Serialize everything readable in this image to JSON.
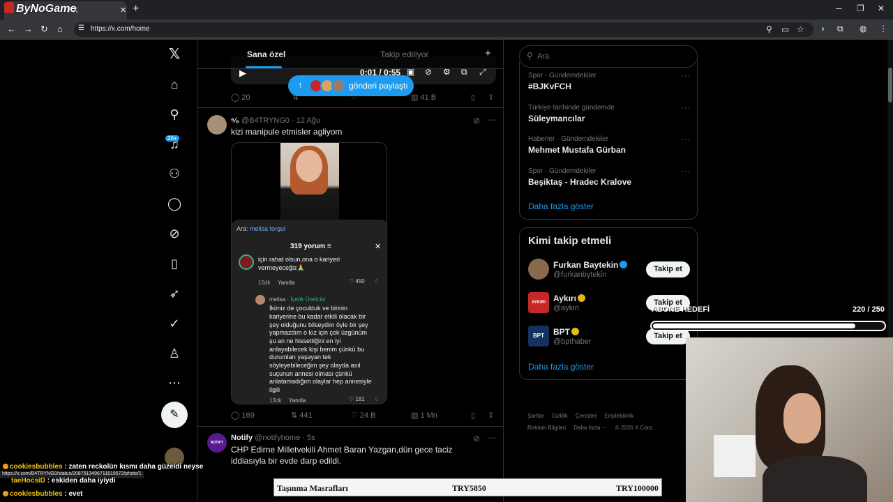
{
  "browser": {
    "tab_title": "/ X",
    "overlay_logo": "ByNoGame",
    "url": "https://x.com/home",
    "status_url": "https://x.com/B4TRYNG0/status/2087513496711819572/photo/1"
  },
  "timeline": {
    "tab_for_you": "Sana özel",
    "tab_following": "Takip ediliyor",
    "video": {
      "time": "0:01 / 0:55"
    },
    "share_pill": "gönderi paylaştı",
    "prev_post_actions": {
      "replies": "20",
      "views": "41 B"
    },
    "post1": {
      "name": "⁶⁄₆",
      "handle": "@B4TRYNG0 · 12 Ağu",
      "text": "kizi manipule etmisler agliyom",
      "media": {
        "search_prefix": "Ara:",
        "search_term": "melisa torgul",
        "comment_count": "319 yorum",
        "comment1_lines": [
          "için rahat olsun,ona o kariyeri",
          "vermeyeceğiz🙏"
        ],
        "comment1_time": "15dk",
        "comment1_reply": "Yanıtla",
        "comment1_likes": "450",
        "reply_author": "melisa",
        "reply_badge": "· İçerik Üreticisi",
        "reply_lines": [
          "İkimiz de çocuktuk ve birinin",
          "kariyerine bu kadar etkili olacak bir",
          "şey olduğunu bilseydim öyle bir şey",
          "yapmazdım o kız için çok üzgünüm",
          "şu an ne hissettiğini en iyi",
          "anlayabilecek kişi benim çünkü bu",
          "durumları yaşayan tek",
          "söyleyebileceğim şey olayda asıl",
          "suçunun annesi olması çünkü",
          "anlatamadığım olaylar hep annesiyle",
          "ilgili"
        ],
        "reply_time": "13dk",
        "reply_reply": "Yanıtla",
        "reply_likes": "181"
      },
      "actions": {
        "replies": "169",
        "reposts": "441",
        "likes": "24 B",
        "views": "1 Mn"
      }
    },
    "post2": {
      "name": "Notify",
      "avatar_text": "NOTIFY",
      "handle": "@notifyhome · 5s",
      "text": "CHP Edirne Milletvekili Ahmet Baran Yazgan,dün gece taciz iddiasıyla bir evde darp edildi."
    }
  },
  "sidebar": {
    "notifications_badge": "20+",
    "search_placeholder": "Ara",
    "trends": [
      {
        "category": "Spor · Gündemdekiler",
        "name": "#BJKvFCH"
      },
      {
        "category": "Türkiye tarihinde gündemde",
        "name": "Süleymancılar"
      },
      {
        "category": "Haberler · Gündemdekiler",
        "name": "Mehmet Mustafa Gürban"
      },
      {
        "category": "Spor · Gündemdekiler",
        "name": "Beşiktaş - Hradec Kralove"
      }
    ],
    "show_more": "Daha fazla göster",
    "who_to_follow_title": "Kimi takip etmeli",
    "who_to_follow": [
      {
        "name": "Furkan Baytekin",
        "handle": "@furkanbytekin",
        "button": "Takip et"
      },
      {
        "name": "Aykırı",
        "handle": "@aykiri",
        "button": "Takip et",
        "avatar_text": "AYKIRI"
      },
      {
        "name": "BPT",
        "handle": "@bpthaber",
        "button": "Takip et",
        "avatar_text": "BPT"
      }
    ],
    "footer": [
      "Şartlar",
      "Gizlilik",
      "Çerezler",
      "Erişilebilirlik",
      "Reklam Bilgileri",
      "Daha fazla ···",
      "© 2026 X Corp."
    ]
  },
  "stream": {
    "goal_label": "ABONE HEDEFİ",
    "goal_value": "220 / 250",
    "goal_progress": 0.88,
    "chat": [
      {
        "user": "cookiesbubbles",
        "message": ": zaten reckolün kısmı daha güzeldi neyse"
      },
      {
        "user": "taeHocsiD",
        "message": ": eskiden daha iyiydi"
      },
      {
        "user": "cookiesbubbles",
        "message": ": evet"
      }
    ],
    "ticker": {
      "label": "Taşınma Masrafları",
      "current": "TRY5850",
      "target": "TRY100000"
    }
  }
}
